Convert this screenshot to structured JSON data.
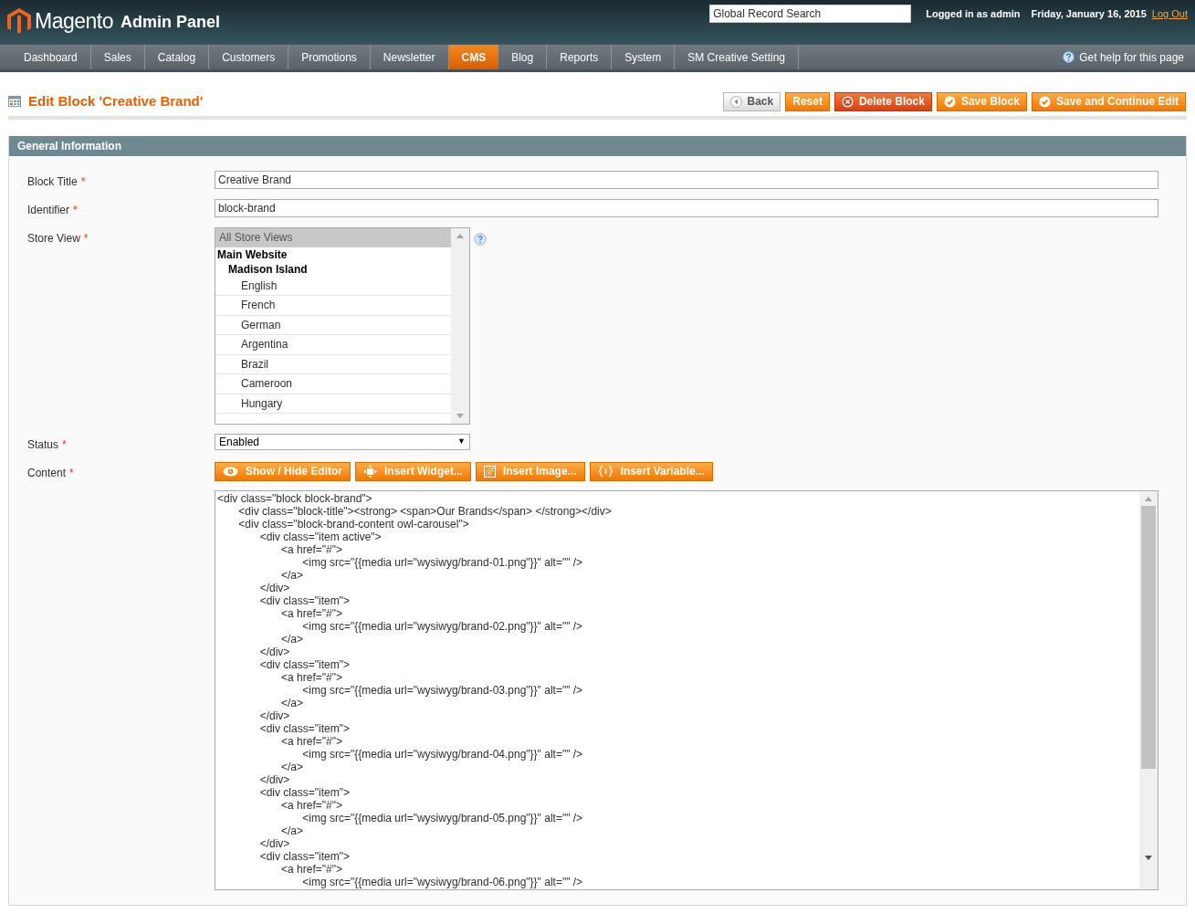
{
  "header": {
    "logo_text": "Magento",
    "logo_sub": "Admin Panel",
    "search": {
      "placeholder": "Global Record Search"
    },
    "logged_in": "Logged in as admin",
    "date": "Friday, January 16, 2015",
    "logout": "Log Out"
  },
  "nav": [
    {
      "label": "Dashboard",
      "selected": false
    },
    {
      "label": "Sales",
      "selected": false
    },
    {
      "label": "Catalog",
      "selected": false
    },
    {
      "label": "Customers",
      "selected": false
    },
    {
      "label": "Promotions",
      "selected": false
    },
    {
      "label": "Newsletter",
      "selected": false
    },
    {
      "label": "CMS",
      "selected": true
    },
    {
      "label": "Blog",
      "selected": false
    },
    {
      "label": "Reports",
      "selected": false
    },
    {
      "label": "System",
      "selected": false
    },
    {
      "label": "SM Creative Setting",
      "selected": false
    }
  ],
  "help_link": "Get help for this page",
  "page_title": "Edit Block 'Creative Brand'",
  "actions": [
    {
      "label": "Back",
      "kind": "back"
    },
    {
      "label": "Reset",
      "kind": "plain"
    },
    {
      "label": "Delete Block",
      "kind": "delete"
    },
    {
      "label": "Save Block",
      "kind": "save"
    },
    {
      "label": "Save and Continue Edit",
      "kind": "save"
    }
  ],
  "section_title": "General Information",
  "fields": [
    {
      "label": "Block Title",
      "required": "*",
      "kind": "text",
      "value": "Creative Brand"
    },
    {
      "label": "Identifier",
      "required": "*",
      "kind": "text",
      "value": "block-brand"
    },
    {
      "label": "Store View",
      "required": "*",
      "kind": "multiselect",
      "options": [
        {
          "label": "All Store Views",
          "selected": true
        },
        {
          "label": "Main Website",
          "children": [
            {
              "label": "Madison Island",
              "children": [
                {
                  "label": "English",
                  "selected": false
                },
                {
                  "label": "French",
                  "selected": false
                },
                {
                  "label": "German",
                  "selected": false
                },
                {
                  "label": "Argentina",
                  "selected": false
                },
                {
                  "label": "Brazil",
                  "selected": false
                },
                {
                  "label": "Cameroon",
                  "selected": false
                },
                {
                  "label": "Hungary",
                  "selected": false
                }
              ]
            }
          ]
        }
      ]
    },
    {
      "label": "Status",
      "required": "*",
      "kind": "select",
      "value": "Enabled",
      "arrow": "▼"
    },
    {
      "label": "Content",
      "required": "*",
      "kind": "editor",
      "buttons": [
        {
          "label": "Show / Hide Editor",
          "kind": "eye"
        },
        {
          "label": "Insert Widget...",
          "kind": "widget"
        },
        {
          "label": "Insert Image...",
          "kind": "image"
        },
        {
          "label": "Insert Variable...",
          "kind": "variable"
        }
      ],
      "value": "<div class=\"block block-brand\">\n\t<div class=\"block-title\"><strong> <span>Our Brands</span> </strong></div>\n\t<div class=\"block-brand-content owl-carousel\">\n\t\t<div class=\"item active\">\n\t\t\t<a href=\"#\">\n\t\t\t\t<img src=\"{{media url=\"wysiwyg/brand-01.png\"}}\" alt=\"\" />\n\t\t\t</a>\n\t\t</div>\n\t\t<div class=\"item\">\n\t\t\t<a href=\"#\">\n\t\t\t\t<img src=\"{{media url=\"wysiwyg/brand-02.png\"}}\" alt=\"\" />\n\t\t\t</a>\n\t\t</div>\n\t\t<div class=\"item\">\n\t\t\t<a href=\"#\">\n\t\t\t\t<img src=\"{{media url=\"wysiwyg/brand-03.png\"}}\" alt=\"\" />\n\t\t\t</a>\n\t\t</div>\n\t\t<div class=\"item\">\n\t\t\t<a href=\"#\">\n\t\t\t\t<img src=\"{{media url=\"wysiwyg/brand-04.png\"}}\" alt=\"\" />\n\t\t\t</a>\n\t\t</div>\n\t\t<div class=\"item\">\n\t\t\t<a href=\"#\">\n\t\t\t\t<img src=\"{{media url=\"wysiwyg/brand-05.png\"}}\" alt=\"\" />\n\t\t\t</a>\n\t\t</div>\n\t\t<div class=\"item\">\n\t\t\t<a href=\"#\">\n\t\t\t\t<img src=\"{{media url=\"wysiwyg/brand-06.png\"}}\" alt=\"\" />"
    }
  ]
}
